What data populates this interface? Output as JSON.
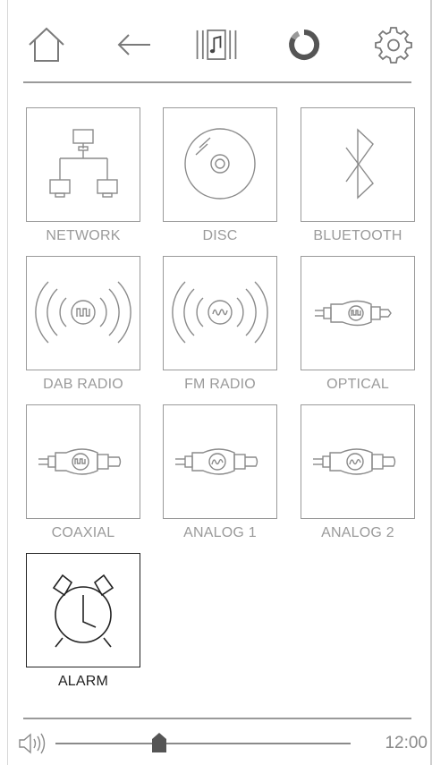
{
  "toolbar": {
    "icons": [
      "home-icon",
      "back-arrow-icon",
      "music-library-icon",
      "assistant-ring-icon",
      "settings-gear-icon"
    ]
  },
  "sources": [
    {
      "id": "network",
      "label": "NETWORK",
      "icon": "network-icon",
      "active": false
    },
    {
      "id": "disc",
      "label": "DISC",
      "icon": "disc-icon",
      "active": false
    },
    {
      "id": "bluetooth",
      "label": "BLUETOOTH",
      "icon": "bluetooth-icon",
      "active": false
    },
    {
      "id": "dab-radio",
      "label": "DAB RADIO",
      "icon": "dab-radio-icon",
      "active": false
    },
    {
      "id": "fm-radio",
      "label": "FM RADIO",
      "icon": "fm-radio-icon",
      "active": false
    },
    {
      "id": "optical",
      "label": "OPTICAL",
      "icon": "optical-connector-icon",
      "active": false
    },
    {
      "id": "coaxial",
      "label": "COAXIAL",
      "icon": "coaxial-connector-icon",
      "active": false
    },
    {
      "id": "analog-1",
      "label": "ANALOG 1",
      "icon": "rca-connector-icon",
      "active": false
    },
    {
      "id": "analog-2",
      "label": "ANALOG 2",
      "icon": "rca-connector-icon",
      "active": false
    },
    {
      "id": "alarm",
      "label": "ALARM",
      "icon": "alarm-clock-icon",
      "active": true
    }
  ],
  "volume": {
    "icon": "speaker-volume-icon",
    "level": 0.35
  },
  "clock": {
    "time": "12:00"
  },
  "colors": {
    "inactive": "#9a9a9a",
    "active": "#222222",
    "background": "#ffffff"
  }
}
